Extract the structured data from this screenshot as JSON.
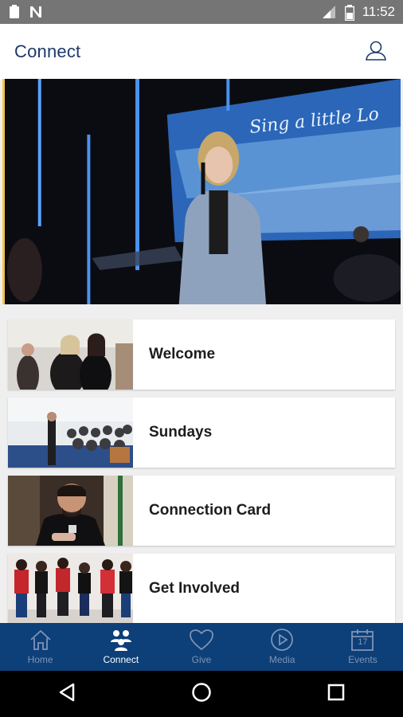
{
  "status_bar": {
    "time": "11:52",
    "icons": [
      "clipboard-icon",
      "n-notification-icon",
      "signal-lte-icon",
      "battery-icon"
    ]
  },
  "header": {
    "title": "Connect",
    "profile_icon": "user-profile-icon"
  },
  "hero": {
    "screen_text": "Sing a little Lo"
  },
  "cards": [
    {
      "label": "Welcome",
      "thumb": "welcome-photo"
    },
    {
      "label": "Sundays",
      "thumb": "sundays-photo"
    },
    {
      "label": "Connection Card",
      "thumb": "connection-card-photo"
    },
    {
      "label": "Get Involved",
      "thumb": "get-involved-photo"
    }
  ],
  "bottom_nav": {
    "items": [
      {
        "label": "Home",
        "icon": "home-icon",
        "active": false
      },
      {
        "label": "Connect",
        "icon": "people-icon",
        "active": true
      },
      {
        "label": "Give",
        "icon": "heart-icon",
        "active": false
      },
      {
        "label": "Media",
        "icon": "play-circle-icon",
        "active": false
      },
      {
        "label": "Events",
        "icon": "calendar-icon",
        "active": false,
        "calendar_day": "17"
      }
    ]
  },
  "colors": {
    "brand_blue": "#0d3f78",
    "title_navy": "#1d3a6b",
    "nav_inactive": "#7d94b6",
    "hero_accent": "#f2c64b"
  },
  "system_nav": {
    "icons": [
      "back-icon",
      "home-circle-icon",
      "recents-icon"
    ]
  }
}
